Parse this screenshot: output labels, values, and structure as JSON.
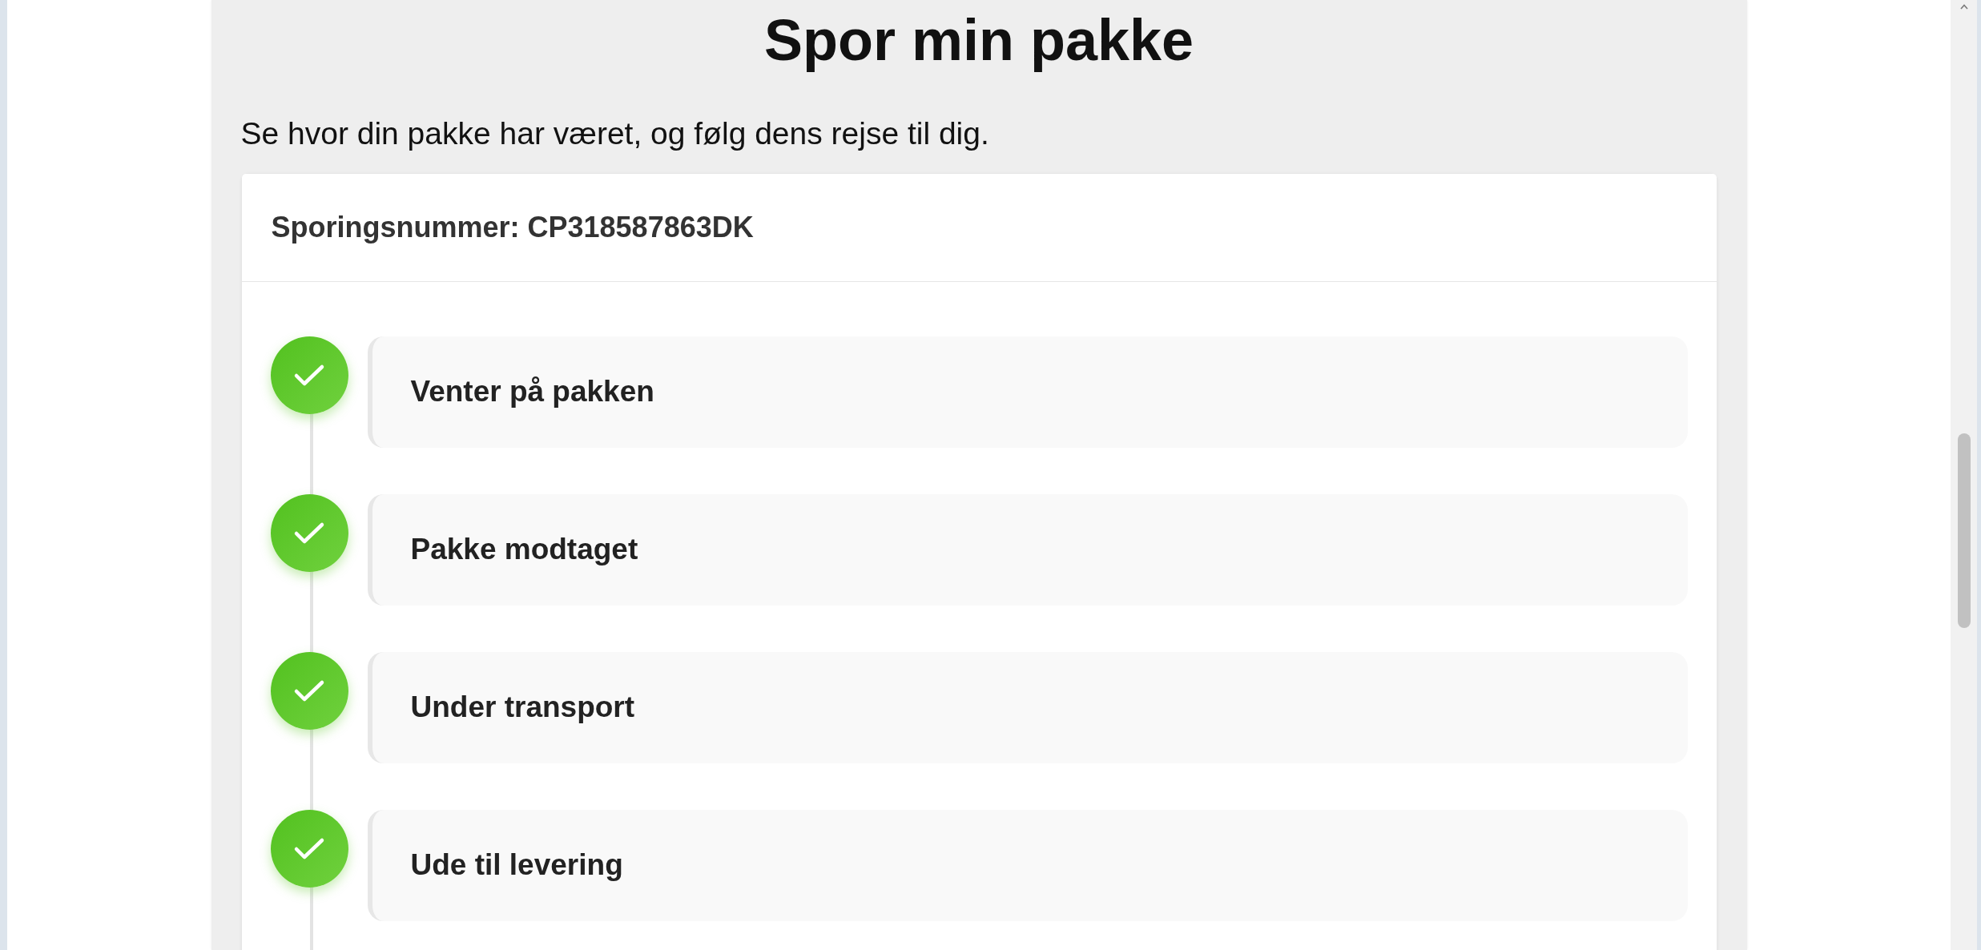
{
  "page": {
    "heading": "Spor min pakke",
    "subtitle": "Se hvor din pakke har været, og følg dens rejse til dig."
  },
  "tracking_card": {
    "header": "Sporingsnummer: CP318587863DK",
    "steps": [
      {
        "label": "Venter på pakken",
        "completed": true
      },
      {
        "label": "Pakke modtaget",
        "completed": true
      },
      {
        "label": "Under transport",
        "completed": true
      },
      {
        "label": "Ude til levering",
        "completed": true
      }
    ]
  }
}
